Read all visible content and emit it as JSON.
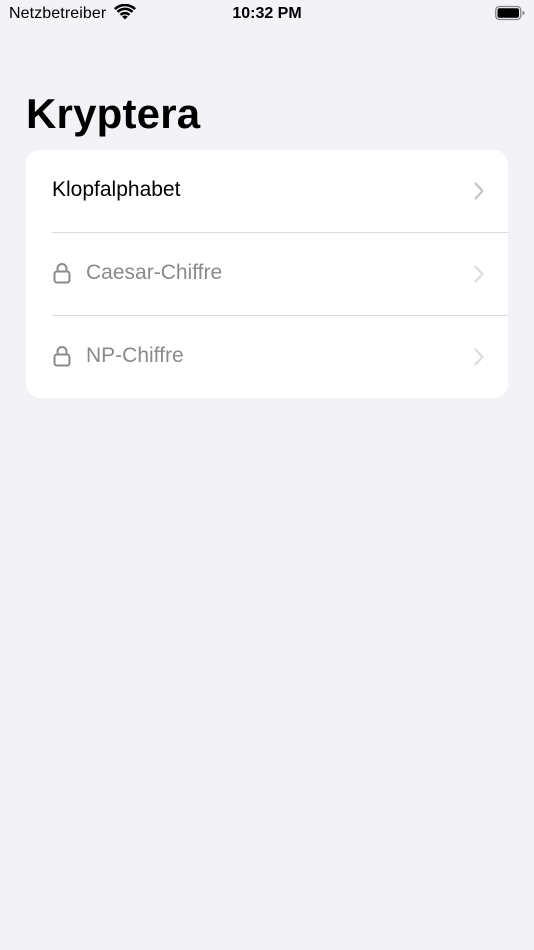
{
  "status_bar": {
    "carrier": "Netzbetreiber",
    "time": "10:32 PM",
    "icons": [
      "wifi-icon",
      "battery-icon"
    ]
  },
  "page": {
    "title": "Kryptera"
  },
  "list": {
    "items": [
      {
        "label": "Klopfalphabet",
        "locked": false,
        "icon": "chevron-right-icon"
      },
      {
        "label": "Caesar-Chiffre",
        "locked": true,
        "icon": "lock-icon"
      },
      {
        "label": "NP-Chiffre",
        "locked": true,
        "icon": "lock-icon"
      }
    ]
  },
  "colors": {
    "background": "#f2f2f7",
    "card": "#ffffff",
    "text": "#000000",
    "disabled_text": "#8a8a8e",
    "chevron": "#c4c4c7"
  }
}
